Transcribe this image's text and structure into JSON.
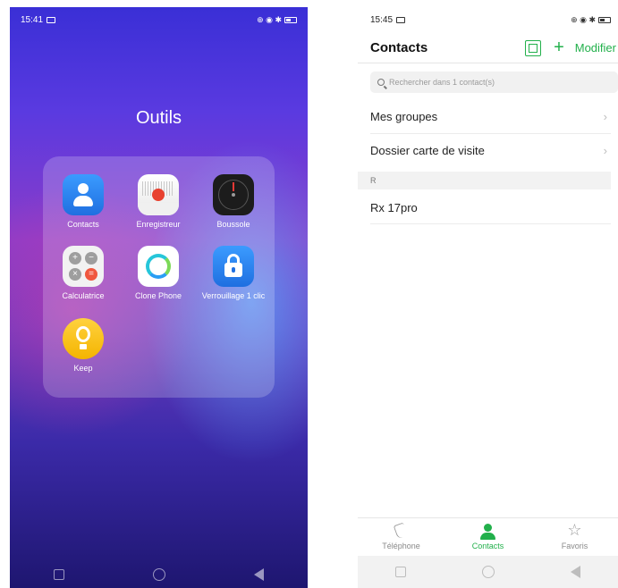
{
  "left_screen": {
    "status": {
      "time": "15:41",
      "icons": "⊕ ◉ ✱"
    },
    "folder_title": "Outils",
    "apps": [
      {
        "label": "Contacts",
        "icon": "contacts-icon"
      },
      {
        "label": "Enregistreur",
        "icon": "recorder-icon"
      },
      {
        "label": "Boussole",
        "icon": "compass-icon"
      },
      {
        "label": "Calculatrice",
        "icon": "calculator-icon"
      },
      {
        "label": "Clone Phone",
        "icon": "clone-phone-icon"
      },
      {
        "label": "Verrouillage 1 clic",
        "icon": "lock-icon"
      },
      {
        "label": "Keep",
        "icon": "keep-icon"
      }
    ]
  },
  "right_screen": {
    "status": {
      "time": "15:45",
      "icons": "⊕ ◉ ✱"
    },
    "header": {
      "title": "Contacts",
      "edit_label": "Modifier"
    },
    "search": {
      "placeholder": "Rechercher dans 1 contact(s)"
    },
    "rows": [
      {
        "label": "Mes groupes"
      },
      {
        "label": "Dossier carte de visite"
      }
    ],
    "section_letter": "R",
    "contacts": [
      {
        "name": "Rx 17pro"
      }
    ],
    "tabs": [
      {
        "label": "Téléphone",
        "active": false
      },
      {
        "label": "Contacts",
        "active": true
      },
      {
        "label": "Favoris",
        "active": false
      }
    ],
    "accent_color": "#22b04b"
  }
}
